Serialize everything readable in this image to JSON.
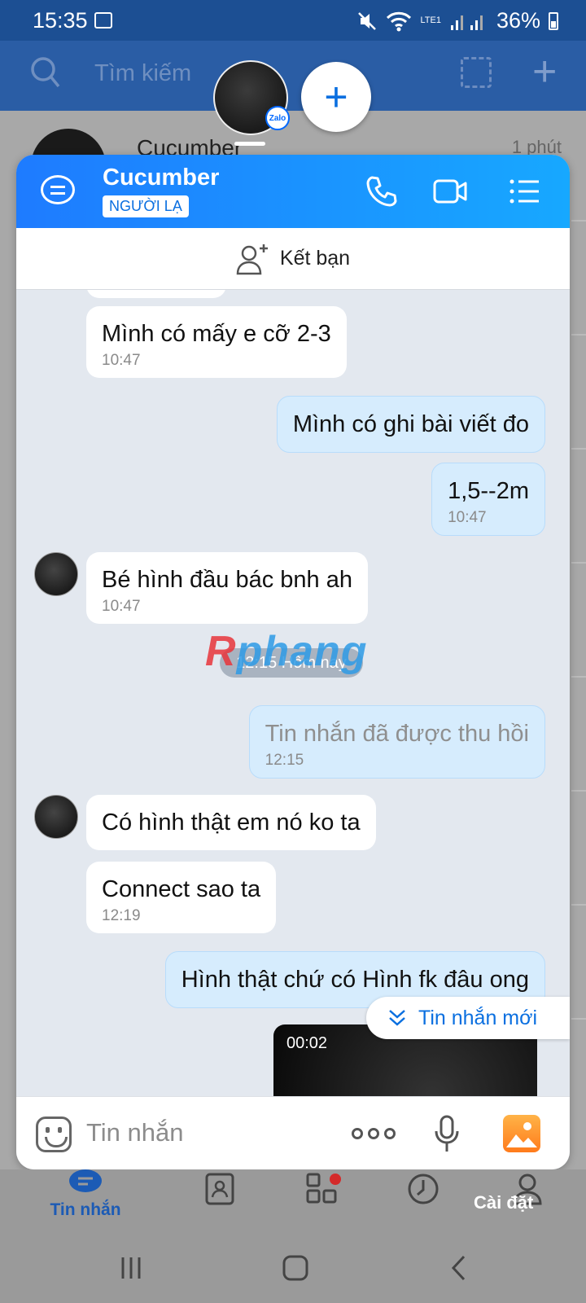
{
  "status": {
    "time": "15:35",
    "battery": "36%",
    "network": "LTE1"
  },
  "topbar": {
    "search_placeholder": "Tìm kiếm"
  },
  "background_list": {
    "row_name": "Cucumber",
    "row_time": "1 phút"
  },
  "chat": {
    "name": "Cucumber",
    "badge": "NGƯỜI LẠ",
    "add_friend": "Kết bạn",
    "date_divider": "12:15 Hôm nay",
    "watermark": {
      "part1": "R",
      "part2": "phang"
    },
    "messages": [
      {
        "dir": "in",
        "text": "Mình có mấy e cỡ 2-3",
        "time": "10:47"
      },
      {
        "dir": "out",
        "text": "Mình có ghi bài viết đo",
        "time": ""
      },
      {
        "dir": "out",
        "text": "1,5--2m",
        "time": "10:47"
      },
      {
        "dir": "in",
        "text": "Bé hình đầu bác bnh ah",
        "time": "10:47"
      },
      {
        "dir": "out",
        "text": "Tin nhắn đã được thu hồi",
        "time": "12:15"
      },
      {
        "dir": "in",
        "text": "Có hình thật em nó ko ta",
        "time": ""
      },
      {
        "dir": "in",
        "text": "Connect sao ta",
        "time": "12:19"
      },
      {
        "dir": "out",
        "text": "Hình thật chứ có Hình fk đâu ong",
        "time": ""
      }
    ],
    "video_duration": "00:02",
    "new_messages_button": "Tin nhắn mới",
    "input_placeholder": "Tin nhắn"
  },
  "bottom_nav": {
    "messages_label": "Tin nhắn",
    "settings_label": "Cài đặt"
  },
  "colors": {
    "accent": "#0a6fe0",
    "header_start": "#1e7bff",
    "header_end": "#17a8ff",
    "outgoing_bubble": "#d6ecfd"
  }
}
